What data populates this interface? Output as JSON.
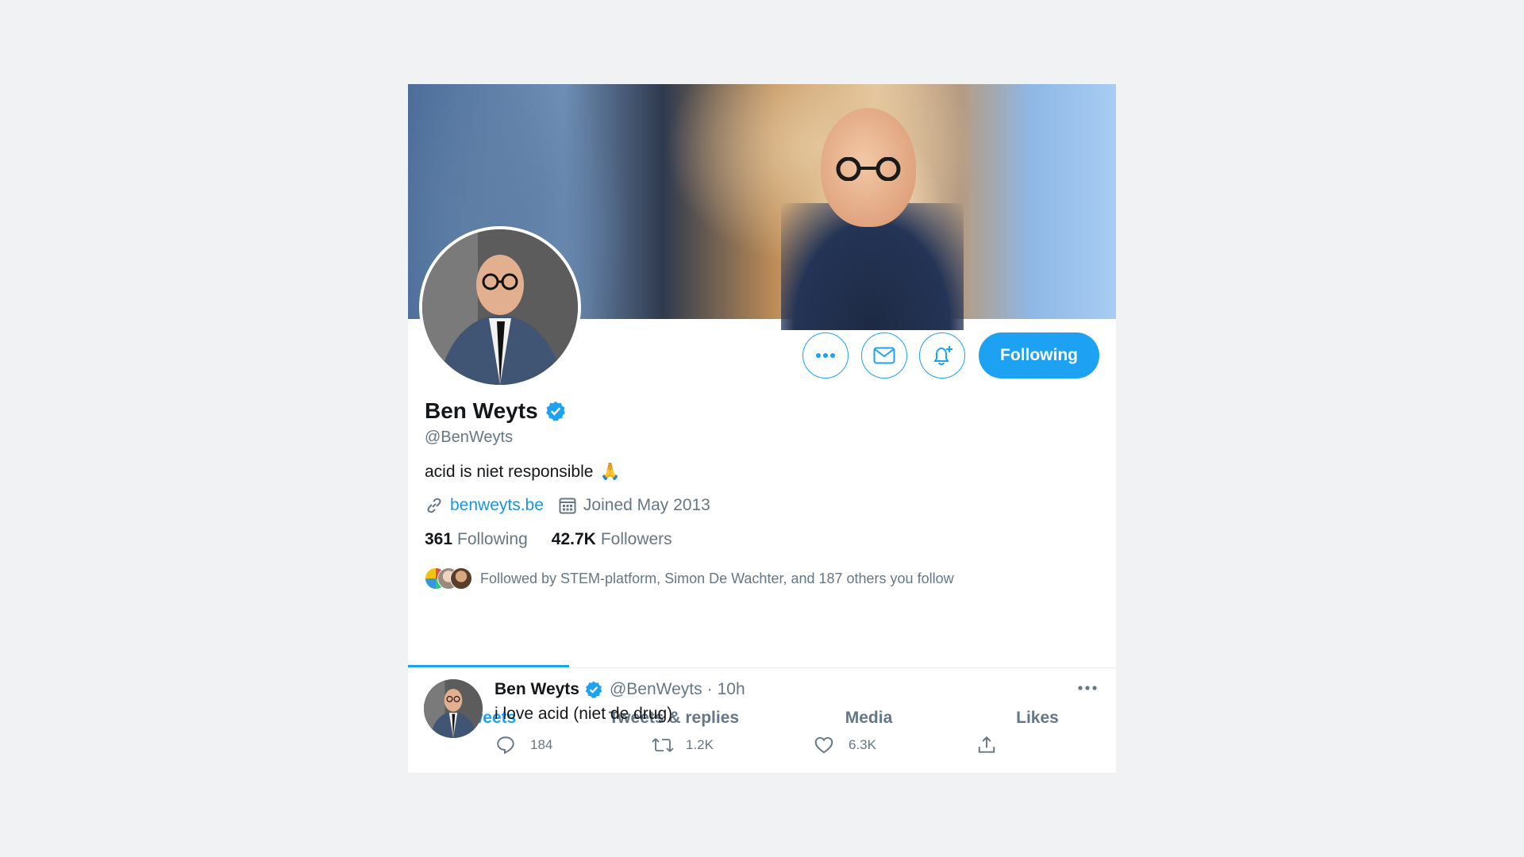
{
  "profile": {
    "name": "Ben Weyts",
    "handle": "@BenWeyts",
    "bio": "acid is niet responsible",
    "bio_emoji": "🙏",
    "website": "benweyts.be",
    "joined": "Joined May 2013",
    "following_count": "361",
    "following_label": "Following",
    "followers_count": "42.7K",
    "followers_label": "Followers",
    "followed_by": "Followed by STEM-platform, Simon De Wachter, and 187 others you follow",
    "follow_button": "Following"
  },
  "tabs": [
    "Tweets",
    "Tweets & replies",
    "Media",
    "Likes"
  ],
  "active_tab": "Tweets",
  "tweet": {
    "name": "Ben Weyts",
    "handle": "@BenWeyts",
    "dot": "·",
    "time": "10h",
    "text": "i love acid (niet de drug)",
    "replies": "184",
    "retweets": "1.2K",
    "likes": "6.3K"
  },
  "colors": {
    "accent": "#1da1f2",
    "link": "#1b95e0",
    "text": "#14171a",
    "muted": "#657786"
  },
  "icons": [
    "more-icon",
    "mail-icon",
    "bell-plus-icon",
    "verified-icon",
    "link-icon",
    "calendar-icon",
    "reply-icon",
    "retweet-icon",
    "like-icon",
    "share-icon"
  ]
}
